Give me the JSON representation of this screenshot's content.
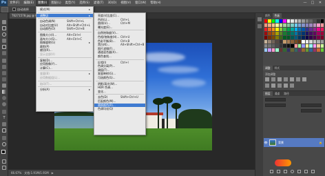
{
  "app": {
    "logo": "Ps"
  },
  "menubar": {
    "items": [
      "文件(F)",
      "编辑(E)",
      "图像(I)",
      "图层(L)",
      "类型(Y)",
      "选择(S)",
      "滤镜(T)",
      "3D(D)",
      "视图(V)",
      "窗口(W)",
      "帮助(H)"
    ],
    "active_index": 2,
    "min": "—",
    "max": "□",
    "close": "✕"
  },
  "options": {
    "auto_select": "自动选择"
  },
  "document": {
    "tab_title": "T6271578.jpg @ 66.7%(RGB/8)"
  },
  "status": {
    "zoom": "66.67%",
    "doc_info": "文档:1.91M/1.91M"
  },
  "panels": {
    "top_tabs": [
      "颜色",
      "色板"
    ],
    "adjust_tabs": [
      "调整",
      "样式"
    ],
    "adjust_label": "添加调整",
    "layers_tabs": [
      "图层",
      "通道",
      "路径"
    ],
    "layer_name": "背景",
    "swatch_colors": [
      "#ff0000",
      "#ffff00",
      "#00ff00",
      "#00ffff",
      "#0000ff",
      "#ff00ff",
      "#ffffff",
      "#e6e6e6",
      "#cccccc",
      "#b3b3b3",
      "#999999",
      "#808080",
      "#666666",
      "#4d4d4d",
      "#333333",
      "#000000",
      "#f7977a",
      "#f9ad81",
      "#fdc68a",
      "#fff79a",
      "#c4df9b",
      "#a2d39c",
      "#82ca9d",
      "#7bcdc8",
      "#6ecff6",
      "#7ea7d8",
      "#8493ca",
      "#8882be",
      "#a187be",
      "#bc8dbf",
      "#f49ac2",
      "#f6989d",
      "#ed1c24",
      "#f26522",
      "#f7941d",
      "#fff200",
      "#8dc63f",
      "#39b54a",
      "#00a651",
      "#00a99d",
      "#00aeef",
      "#0072bc",
      "#0054a6",
      "#2e3192",
      "#662d91",
      "#92278f",
      "#ec008c",
      "#ed145b",
      "#9e0b0f",
      "#a0410d",
      "#a36209",
      "#aba000",
      "#598527",
      "#1a7b30",
      "#007236",
      "#00746b",
      "#0076a3",
      "#004b80",
      "#003471",
      "#1b1464",
      "#440e62",
      "#630460",
      "#9e005d",
      "#9e0039",
      "#790000",
      "#7b2e00",
      "#7d4900",
      "#827b00",
      "#406618",
      "#005e20",
      "#005826",
      "#005952",
      "#005b7f",
      "#003663",
      "#002157",
      "#0d004c",
      "#32004b",
      "#4b0049",
      "#7b0046",
      "#7a0026",
      "#c7b299",
      "#998675",
      "#736357",
      "#534741",
      "#37302d",
      "#c69c6d",
      "#a67c52",
      "#8c6239",
      "#754c24",
      "#603913",
      "#ffffff",
      "#ebebeb",
      "#d7d7d7",
      "#c3c3c3",
      "#afafaf",
      "#9b9b9b",
      "#878787",
      "#737373",
      "#5f5f5f",
      "#4b4b4b",
      "#373737",
      "#232323",
      "#0f0f0f",
      "#000000",
      "#ff9999",
      "#99ff99",
      "#9999ff",
      "#ffff99",
      "#99ffff",
      "#ff99ff",
      "#ffcc99",
      "#ccff99",
      "#99ccff",
      "#cc99ff",
      "#ff99cc",
      "#99ffcc",
      "#663333",
      "#336633",
      "#333366",
      "#666633",
      "#336666",
      "#663366",
      "#996633",
      "#669933",
      "#336699",
      "#993366",
      "#cc6633",
      "#66cc33"
    ]
  },
  "image_menu": {
    "items": [
      {
        "label": "模式(M)",
        "shortcut": "",
        "submenu": true,
        "disabled": false
      },
      {
        "sep": true
      },
      {
        "label": "调整(J)",
        "shortcut": "",
        "submenu": true,
        "disabled": false,
        "highlight": true
      },
      {
        "sep": true
      },
      {
        "label": "自动色调(N)",
        "shortcut": "Shift+Ctrl+L",
        "submenu": false,
        "disabled": false
      },
      {
        "label": "自动对比度(U)",
        "shortcut": "Alt+Shift+Ctrl+L",
        "submenu": false,
        "disabled": false
      },
      {
        "label": "自动颜色(O)",
        "shortcut": "Shift+Ctrl+B",
        "submenu": false,
        "disabled": false
      },
      {
        "sep": true
      },
      {
        "label": "图像大小(I)...",
        "shortcut": "Alt+Ctrl+I",
        "submenu": false,
        "disabled": false
      },
      {
        "label": "画布大小(S)...",
        "shortcut": "Alt+Ctrl+C",
        "submenu": false,
        "disabled": false
      },
      {
        "label": "图像旋转(G)",
        "shortcut": "",
        "submenu": true,
        "disabled": false
      },
      {
        "label": "裁剪(P)",
        "shortcut": "",
        "submenu": false,
        "disabled": false
      },
      {
        "label": "裁切(R)...",
        "shortcut": "",
        "submenu": false,
        "disabled": false
      },
      {
        "label": "显示全部(V)",
        "shortcut": "",
        "submenu": false,
        "disabled": true
      },
      {
        "sep": true
      },
      {
        "label": "复制(D)...",
        "shortcut": "",
        "submenu": false,
        "disabled": false
      },
      {
        "label": "应用图像(Y)...",
        "shortcut": "",
        "submenu": false,
        "disabled": false
      },
      {
        "label": "计算(C)...",
        "shortcut": "",
        "submenu": false,
        "disabled": false
      },
      {
        "sep": true
      },
      {
        "label": "变量(B)",
        "shortcut": "",
        "submenu": true,
        "disabled": true
      },
      {
        "label": "应用数据组(L)...",
        "shortcut": "",
        "submenu": false,
        "disabled": true
      },
      {
        "sep": true
      },
      {
        "label": "陷印(T)...",
        "shortcut": "",
        "submenu": false,
        "disabled": true
      },
      {
        "sep": true
      },
      {
        "label": "分析(A)",
        "shortcut": "",
        "submenu": true,
        "disabled": false
      }
    ]
  },
  "adjust_menu": {
    "items": [
      {
        "label": "亮度/对比度(C)...",
        "shortcut": ""
      },
      {
        "label": "色阶(L)...",
        "shortcut": "Ctrl+L"
      },
      {
        "label": "曲线(U)...",
        "shortcut": "Ctrl+M"
      },
      {
        "label": "曝光度(E)...",
        "shortcut": ""
      },
      {
        "sep": true
      },
      {
        "label": "自然饱和度(V)...",
        "shortcut": ""
      },
      {
        "label": "色相/饱和度(H)...",
        "shortcut": "Ctrl+U"
      },
      {
        "label": "色彩平衡(B)...",
        "shortcut": "Ctrl+B"
      },
      {
        "label": "黑白(K)...",
        "shortcut": "Alt+Shift+Ctrl+B"
      },
      {
        "label": "照片滤镜(F)...",
        "shortcut": ""
      },
      {
        "label": "通道混合器(X)...",
        "shortcut": ""
      },
      {
        "label": "颜色查找...",
        "shortcut": ""
      },
      {
        "sep": true
      },
      {
        "label": "反相(I)",
        "shortcut": "Ctrl+I"
      },
      {
        "label": "色调分离(P)...",
        "shortcut": ""
      },
      {
        "label": "阈值(T)...",
        "shortcut": ""
      },
      {
        "label": "渐变映射(G)...",
        "shortcut": ""
      },
      {
        "label": "可选颜色(S)...",
        "shortcut": ""
      },
      {
        "sep": true
      },
      {
        "label": "阴影/高光(W)...",
        "shortcut": ""
      },
      {
        "label": "HDR 色调...",
        "shortcut": ""
      },
      {
        "label": "变化...",
        "shortcut": ""
      },
      {
        "sep": true
      },
      {
        "label": "去色(D)",
        "shortcut": "Shift+Ctrl+U"
      },
      {
        "label": "匹配颜色(M)...",
        "shortcut": ""
      },
      {
        "label": "替换颜色(R)...",
        "shortcut": "",
        "highlight": true
      },
      {
        "label": "色调均化(Q)",
        "shortcut": ""
      }
    ]
  }
}
